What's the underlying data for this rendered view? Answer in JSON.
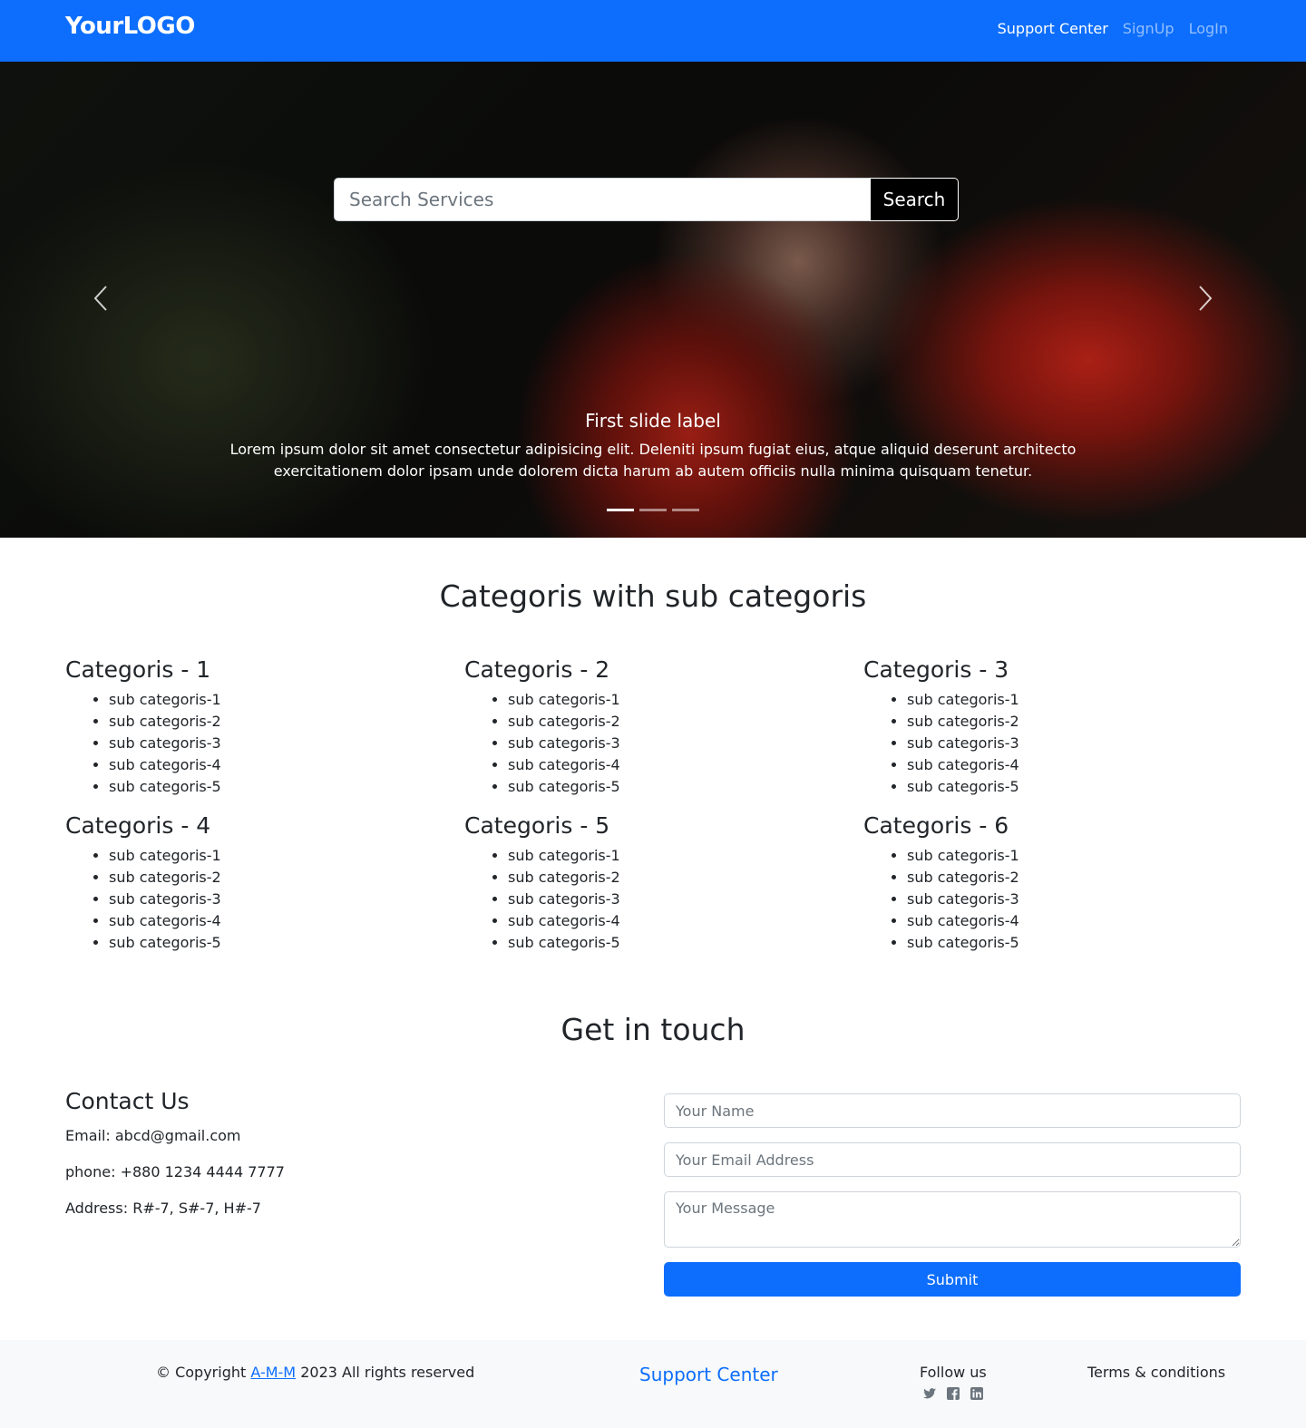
{
  "navbar": {
    "logo": "YourLOGO",
    "links": [
      "Support Center",
      "SignUp",
      "LogIn"
    ]
  },
  "hero": {
    "search_placeholder": "Search Services",
    "search_button": "Search",
    "caption_title": "First slide label",
    "caption_text": "Lorem ipsum dolor sit amet consectetur adipisicing elit. Deleniti ipsum fugiat eius, atque aliquid deserunt architecto exercitationem dolor ipsam unde dolorem dicta harum ab autem officiis nulla minima quisquam tenetur."
  },
  "categories": {
    "title": "Categoris with sub categoris",
    "items": [
      {
        "name": "Categoris - 1",
        "subs": [
          "sub categoris-1",
          "sub categoris-2",
          "sub categoris-3",
          "sub categoris-4",
          "sub categoris-5"
        ]
      },
      {
        "name": "Categoris - 2",
        "subs": [
          "sub categoris-1",
          "sub categoris-2",
          "sub categoris-3",
          "sub categoris-4",
          "sub categoris-5"
        ]
      },
      {
        "name": "Categoris - 3",
        "subs": [
          "sub categoris-1",
          "sub categoris-2",
          "sub categoris-3",
          "sub categoris-4",
          "sub categoris-5"
        ]
      },
      {
        "name": "Categoris - 4",
        "subs": [
          "sub categoris-1",
          "sub categoris-2",
          "sub categoris-3",
          "sub categoris-4",
          "sub categoris-5"
        ]
      },
      {
        "name": "Categoris - 5",
        "subs": [
          "sub categoris-1",
          "sub categoris-2",
          "sub categoris-3",
          "sub categoris-4",
          "sub categoris-5"
        ]
      },
      {
        "name": "Categoris - 6",
        "subs": [
          "sub categoris-1",
          "sub categoris-2",
          "sub categoris-3",
          "sub categoris-4",
          "sub categoris-5"
        ]
      }
    ]
  },
  "contact": {
    "section_title": "Get in touch",
    "heading": "Contact Us",
    "email_label": "Email:",
    "email_value": "abcd@gmail.com",
    "phone_label": "phone:",
    "phone_value": "+880 1234 4444 7777",
    "address_label": "Address:",
    "address_value": "R#-7, S#-7, H#-7",
    "name_placeholder": "Your Name",
    "email_placeholder": "Your Email Address",
    "message_placeholder": "Your Message",
    "submit_label": "Submit"
  },
  "footer": {
    "copyright_prefix": "© Copyright",
    "copyright_link": "A-M-M",
    "copyright_suffix": "2023 All rights reserved",
    "support_center": "Support Center",
    "follow_us": "Follow us",
    "social_icons": [
      "twitter-icon",
      "facebook-icon",
      "linkedin-icon"
    ],
    "terms": "Terms & conditions"
  },
  "colors": {
    "primary": "#0d6efd",
    "footer_bg": "#f8f9fa",
    "text": "#212529"
  }
}
